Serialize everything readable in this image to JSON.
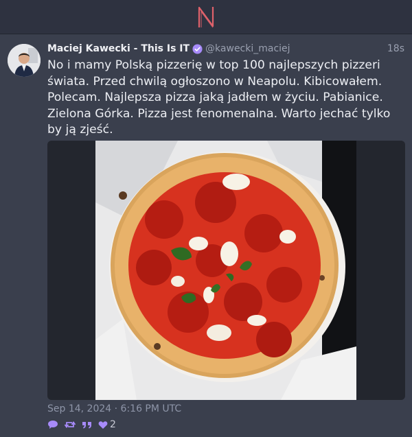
{
  "app": {
    "logo_letter": "N",
    "accent_color": "#e0626b"
  },
  "post": {
    "author": {
      "display_name": "Maciej Kawecki - This Is IT",
      "handle": "@kawecki_maciej",
      "verified": true
    },
    "relative_time": "18s",
    "text": "No i mamy Polską pizzerię w top 100 najlepszych pizzeri świata. Przed chwilą ogłoszono w Neapolu. Kibicowałem. Polecam. Najlepsza pizza jaką jadłem w życiu. Pabianice. Zielona Górka. Pizza jest fenomenalna. Warto jechać tylko by ją zjeść.",
    "date": "Sep 14, 2024 · 6:16 PM UTC",
    "stats": {
      "likes": "2"
    },
    "icons": [
      "reply-icon",
      "repost-icon",
      "quote-icon",
      "heart-icon"
    ],
    "action_color": "#a78bfa"
  }
}
